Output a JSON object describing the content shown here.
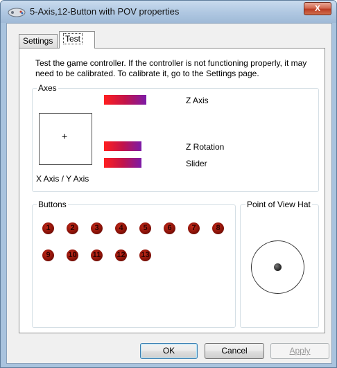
{
  "window": {
    "title": "5-Axis,12-Button with POV  properties",
    "close_label": "X"
  },
  "tabs": [
    {
      "label": "Settings",
      "active": false
    },
    {
      "label": "Test",
      "active": true
    }
  ],
  "description": "Test the game controller.  If the controller is not functioning properly, it may need to be calibrated.  To calibrate it, go to the Settings page.",
  "axes": {
    "title": "Axes",
    "xy_label": "X Axis / Y Axis",
    "crosshair": "+",
    "z_axis_label": "Z Axis",
    "z_rotation_label": "Z Rotation",
    "slider_label": "Slider"
  },
  "buttons_group": {
    "title": "Buttons",
    "items": [
      "1",
      "2",
      "3",
      "4",
      "5",
      "6",
      "7",
      "8",
      "9",
      "10",
      "11",
      "12",
      "13"
    ]
  },
  "pov": {
    "title": "Point of View Hat"
  },
  "footer": {
    "ok_label": "OK",
    "cancel_label": "Cancel",
    "apply_label": "Apply"
  },
  "colors": {
    "bar_start": "#ff1f1f",
    "bar_end": "#7c1aa8",
    "button_indicator": "#8c1208"
  }
}
